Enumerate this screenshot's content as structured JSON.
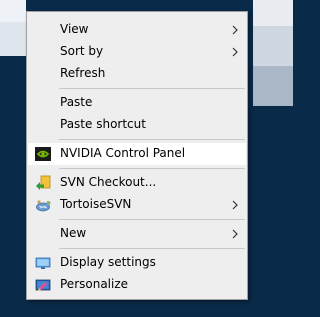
{
  "menu": {
    "items": [
      {
        "label": "View"
      },
      {
        "label": "Sort by"
      },
      {
        "label": "Refresh"
      },
      {
        "label": "Paste"
      },
      {
        "label": "Paste shortcut"
      },
      {
        "label": "NVIDIA Control Panel"
      },
      {
        "label": "SVN Checkout..."
      },
      {
        "label": "TortoiseSVN"
      },
      {
        "label": "New"
      },
      {
        "label": "Display settings"
      },
      {
        "label": "Personalize"
      }
    ],
    "icons": {
      "nvidia": "nvidia-icon",
      "svn": "svn-checkout-icon",
      "tortoise": "tortoisesvn-icon",
      "display": "display-settings-icon",
      "personalize": "personalize-icon"
    },
    "hover_item": "NVIDIA Control Panel",
    "colors": {
      "menu_bg": "#eeeeee",
      "hover_bg": "#ffffff",
      "nvidia_green": "#76b900"
    }
  }
}
